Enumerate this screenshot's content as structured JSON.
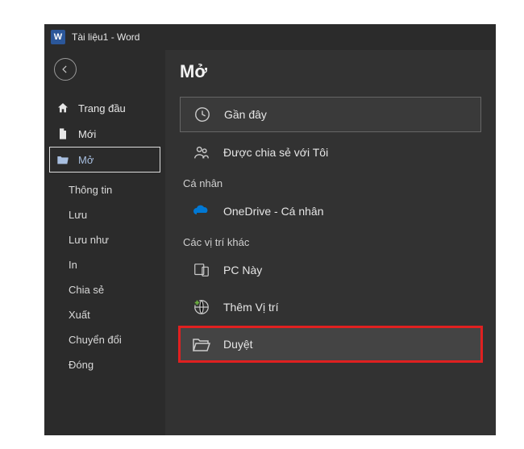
{
  "titlebar": {
    "app_letter": "W",
    "title": "Tài liệu1 - Word"
  },
  "sidebar": {
    "items": [
      {
        "key": "home",
        "label": "Trang đầu"
      },
      {
        "key": "new",
        "label": "Mới"
      },
      {
        "key": "open",
        "label": "Mở"
      }
    ],
    "sub_items": [
      {
        "label": "Thông tin"
      },
      {
        "label": "Lưu"
      },
      {
        "label": "Lưu như"
      },
      {
        "label": "In"
      },
      {
        "label": "Chia sẻ"
      },
      {
        "label": "Xuất"
      },
      {
        "label": "Chuyển đổi"
      },
      {
        "label": "Đóng"
      }
    ]
  },
  "content": {
    "title": "Mở",
    "options": {
      "recent": "Gần đây",
      "shared": "Được chia sẻ với Tôi"
    },
    "personal_label": "Cá nhân",
    "onedrive": "OneDrive - Cá nhân",
    "other_label": "Các vị trí khác",
    "thispc": "PC Này",
    "addplace": "Thêm Vị trí",
    "browse": "Duyệt"
  }
}
